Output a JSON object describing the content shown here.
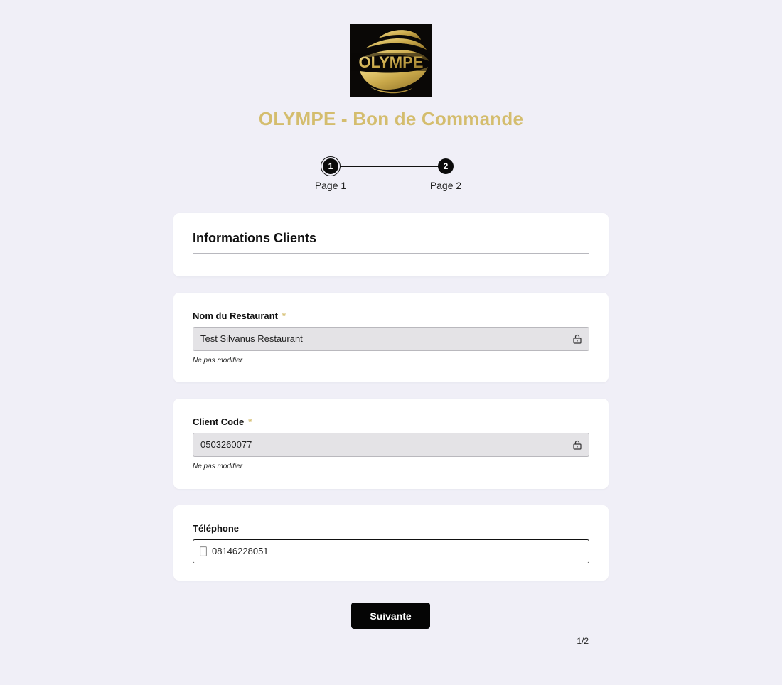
{
  "logo": {
    "text": "OLYMPE"
  },
  "form": {
    "title": "OLYMPE - Bon de Commande"
  },
  "stepper": {
    "steps": [
      {
        "number": "1",
        "label": "Page 1"
      },
      {
        "number": "2",
        "label": "Page 2"
      }
    ]
  },
  "section": {
    "title": "Informations Clients"
  },
  "fields": {
    "restaurant_name": {
      "label": "Nom du Restaurant",
      "required": "*",
      "value": "Test Silvanus Restaurant",
      "help": "Ne pas modifier",
      "icon": "lock-icon"
    },
    "client_code": {
      "label": "Client Code",
      "required": "*",
      "value": "0503260077",
      "help": "Ne pas modifier",
      "icon": "lock-icon"
    },
    "telephone": {
      "label": "Téléphone",
      "value": "08146228051",
      "icon": "phone-icon"
    }
  },
  "navigation": {
    "next_label": "Suivante",
    "page_indicator": "1/2"
  },
  "colors": {
    "accent_gold": "#d4bd6e",
    "background": "#f0eff7",
    "button": "#050505"
  }
}
